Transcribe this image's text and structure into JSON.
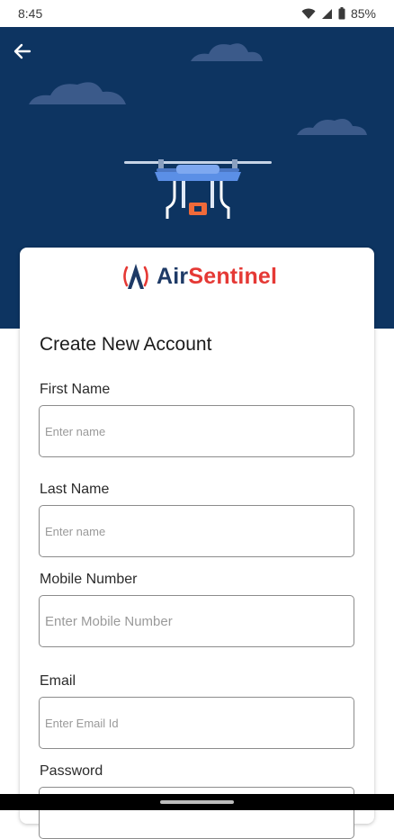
{
  "status_bar": {
    "time": "8:45",
    "battery": "85%",
    "icons": [
      "wifi-icon",
      "signal-icon",
      "battery-icon"
    ]
  },
  "header": {
    "back_icon": "arrow-left-icon",
    "illustration": "drone-icon",
    "colors": {
      "background": "#0d3461",
      "cloud": "#3b5a8a"
    }
  },
  "brand": {
    "logo_part1": "Air",
    "logo_part2": "Sentinel",
    "colors": {
      "primary": "#e53935",
      "secondary": "#1e3a66"
    }
  },
  "form": {
    "title": "Create New Account",
    "fields": [
      {
        "label": "First Name",
        "placeholder": "Enter name",
        "value": ""
      },
      {
        "label": "Last Name",
        "placeholder": "Enter name",
        "value": ""
      },
      {
        "label": "Mobile Number",
        "placeholder": "Enter Mobile Number",
        "value": ""
      },
      {
        "label": "Email",
        "placeholder": "Enter Email Id",
        "value": ""
      },
      {
        "label": "Password",
        "placeholder": "",
        "value": ""
      }
    ]
  }
}
